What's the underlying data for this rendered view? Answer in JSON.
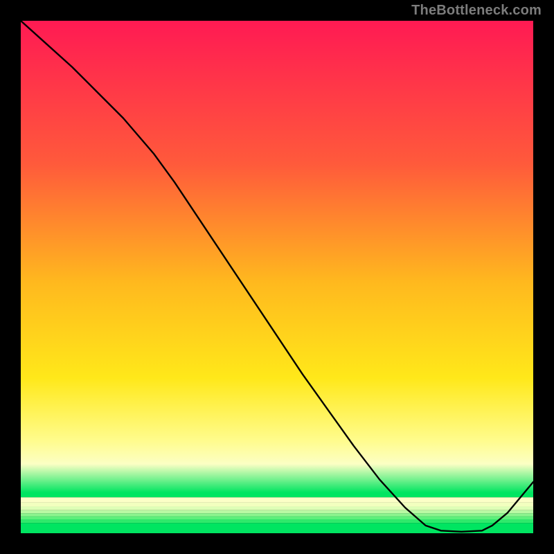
{
  "watermark_text": "TheBottleneck.com",
  "chart_data": {
    "type": "line",
    "title": "",
    "xlabel": "",
    "ylabel": "",
    "xlim": [
      0,
      100
    ],
    "ylim": [
      0,
      100
    ],
    "grid": false,
    "legend": false,
    "background_gradient": {
      "stops": [
        {
          "offset": 0.0,
          "color": "#ff1a53"
        },
        {
          "offset": 0.3,
          "color": "#ff5a3b"
        },
        {
          "offset": 0.55,
          "color": "#ffb91e"
        },
        {
          "offset": 0.75,
          "color": "#ffe81a"
        },
        {
          "offset": 0.88,
          "color": "#fffc8c"
        },
        {
          "offset": 0.93,
          "color": "#fcffc4"
        },
        {
          "offset": 0.99,
          "color": "#00e561"
        }
      ]
    },
    "series": [
      {
        "name": "curve",
        "color": "#000000",
        "x": [
          0,
          5,
          10,
          15,
          20,
          23,
          26,
          30,
          35,
          40,
          45,
          50,
          55,
          60,
          65,
          70,
          75,
          79,
          82,
          86,
          90,
          92,
          95,
          100
        ],
        "y": [
          100,
          95.5,
          91,
          86,
          81,
          77.5,
          74,
          68.5,
          61,
          53.5,
          46,
          38.5,
          31,
          24,
          17,
          10.5,
          5,
          1.5,
          0.5,
          0.3,
          0.5,
          1.5,
          4,
          10
        ]
      }
    ]
  }
}
